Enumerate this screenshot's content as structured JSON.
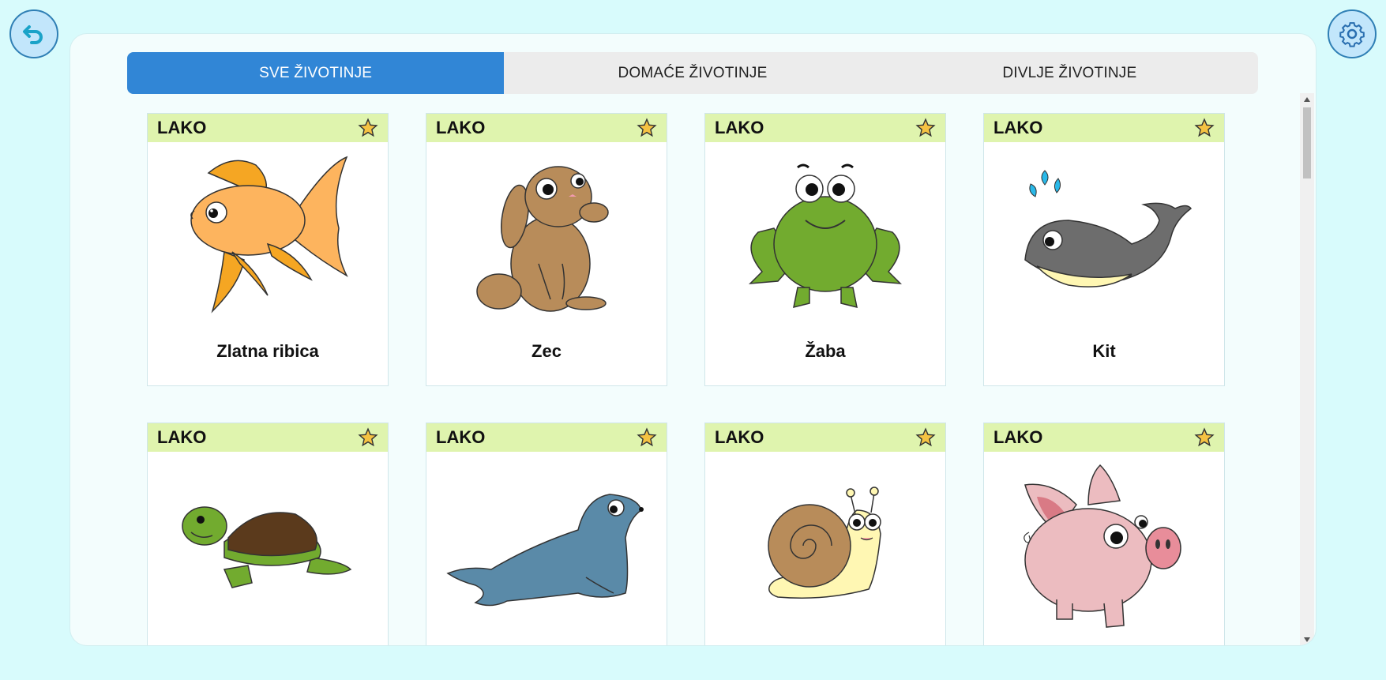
{
  "buttons": {
    "back_icon": "back-arrow-icon",
    "settings_icon": "gear-icon"
  },
  "tabs": [
    {
      "label": "SVE ŽIVOTINJE",
      "active": true
    },
    {
      "label": "DOMAĆE ŽIVOTINJE",
      "active": false
    },
    {
      "label": "DIVLJE ŽIVOTINJE",
      "active": false
    }
  ],
  "cards": [
    {
      "level": "LAKO",
      "name": "Zlatna ribica",
      "icon": "goldfish-illustration"
    },
    {
      "level": "LAKO",
      "name": "Zec",
      "icon": "rabbit-illustration"
    },
    {
      "level": "LAKO",
      "name": "Žaba",
      "icon": "frog-illustration"
    },
    {
      "level": "LAKO",
      "name": "Kit",
      "icon": "whale-illustration"
    },
    {
      "level": "LAKO",
      "name": "",
      "icon": "turtle-illustration"
    },
    {
      "level": "LAKO",
      "name": "",
      "icon": "seal-illustration"
    },
    {
      "level": "LAKO",
      "name": "",
      "icon": "snail-illustration"
    },
    {
      "level": "LAKO",
      "name": "",
      "icon": "pig-illustration"
    }
  ],
  "colors": {
    "background": "#d8fbfc",
    "active_tab": "#3186d6",
    "card_header": "#dff4ae",
    "star": "#f5c242"
  }
}
